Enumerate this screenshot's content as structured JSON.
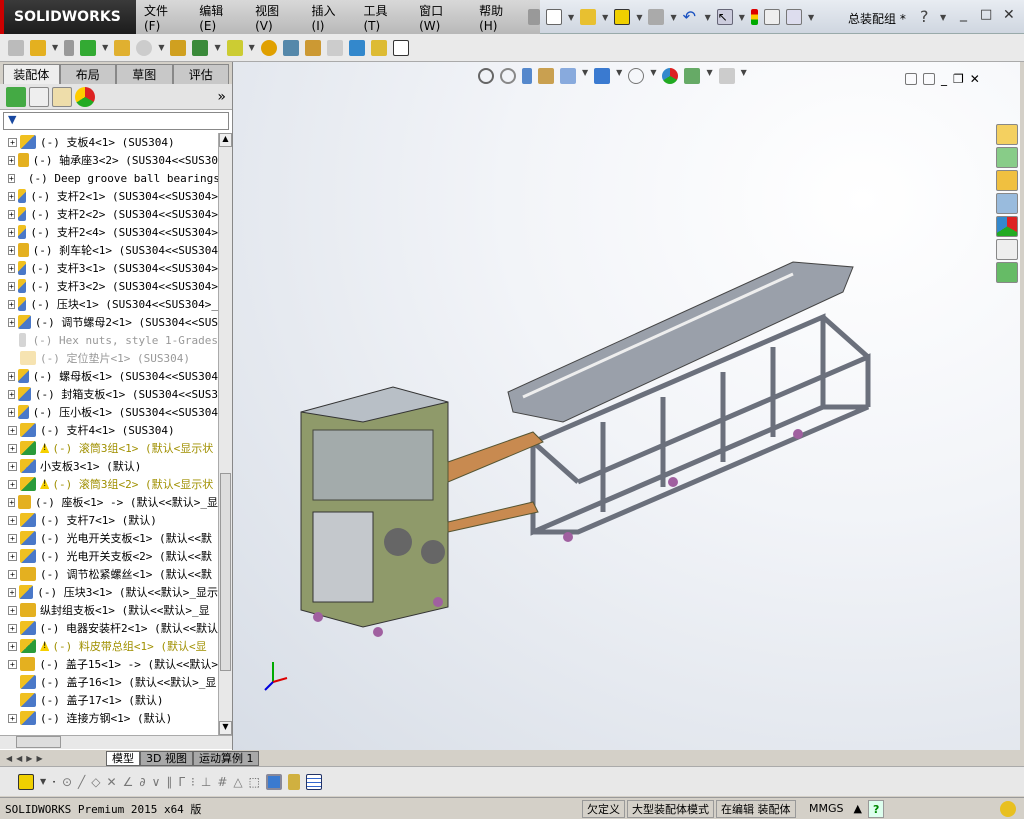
{
  "app": {
    "logo": "SOLIDWORKS",
    "doc_title": "总装配组 *"
  },
  "menu": [
    "文件(F)",
    "编辑(E)",
    "视图(V)",
    "插入(I)",
    "工具(T)",
    "窗口(W)",
    "帮助(H)"
  ],
  "panel_tabs": [
    "装配体",
    "布局",
    "草图",
    "评估"
  ],
  "panel_more": "»",
  "tree": [
    {
      "t": "(-) 支板4<1> (SUS304)",
      "k": "asm"
    },
    {
      "t": "(-) 轴承座3<2> (SUS304<<SUS30",
      "k": "part"
    },
    {
      "t": "(-) Deep groove ball bearings",
      "k": "tool"
    },
    {
      "t": "(-) 支杆2<1> (SUS304<<SUS304>",
      "k": "asm"
    },
    {
      "t": "(-) 支杆2<2> (SUS304<<SUS304>",
      "k": "asm"
    },
    {
      "t": "(-) 支杆2<4> (SUS304<<SUS304>",
      "k": "asm"
    },
    {
      "t": "(-) 刹车轮<1> (SUS304<<SUS304",
      "k": "part"
    },
    {
      "t": "(-) 支杆3<1> (SUS304<<SUS304>",
      "k": "asm"
    },
    {
      "t": "(-) 支杆3<2> (SUS304<<SUS304>",
      "k": "asm"
    },
    {
      "t": "(-) 压块<1> (SUS304<<SUS304>_",
      "k": "asm"
    },
    {
      "t": "(-) 调节螺母2<1> (SUS304<<SUS",
      "k": "asm"
    },
    {
      "t": "(-) Hex nuts, style 1-Grades",
      "k": "tool",
      "s": "sup"
    },
    {
      "t": "(-) 定位垫片<1> (SUS304)",
      "k": "part",
      "s": "sup"
    },
    {
      "t": "(-) 螺母板<1> (SUS304<<SUS304",
      "k": "asm"
    },
    {
      "t": "(-) 封箱支板<1> (SUS304<<SUS3",
      "k": "asm"
    },
    {
      "t": "(-) 压小板<1> (SUS304<<SUS304",
      "k": "asm"
    },
    {
      "t": "(-) 支杆4<1> (SUS304)",
      "k": "asm"
    },
    {
      "t": "(-) 滚筒3组<1> (默认<显示状",
      "k": "sub",
      "s": "ylw"
    },
    {
      "t": "小支板3<1> (默认)",
      "k": "asm"
    },
    {
      "t": "(-) 滚筒3组<2> (默认<显示状",
      "k": "sub",
      "s": "ylw"
    },
    {
      "t": "(-) 座板<1> -> (默认<<默认>_显",
      "k": "part"
    },
    {
      "t": "(-) 支杆7<1> (默认)",
      "k": "asm"
    },
    {
      "t": "(-) 光电开关支板<1> (默认<<默",
      "k": "asm"
    },
    {
      "t": "(-) 光电开关支板<2> (默认<<默",
      "k": "asm"
    },
    {
      "t": "(-) 调节松紧螺丝<1> (默认<<默",
      "k": "part"
    },
    {
      "t": "(-) 压块3<1> (默认<<默认>_显示",
      "k": "asm"
    },
    {
      "t": "纵封组支板<1> (默认<<默认>_显",
      "k": "part"
    },
    {
      "t": "(-) 电器安装杆2<1> (默认<<默认",
      "k": "asm"
    },
    {
      "t": "(-) 料皮带总组<1> (默认<显",
      "k": "sub",
      "s": "ylw"
    },
    {
      "t": "(-) 盖子15<1> -> (默认<<默认>",
      "k": "part"
    },
    {
      "t": "(-) 盖子16<1> (默认<<默认>_显",
      "k": "asm",
      "nx": true
    },
    {
      "t": "(-) 盖子17<1> (默认)",
      "k": "asm",
      "nx": true
    },
    {
      "t": "(-) 连接方钢<1> (默认)",
      "k": "asm"
    }
  ],
  "bottom_tabs": [
    "模型",
    "3D 视图",
    "运动算例 1"
  ],
  "status": {
    "product": "SOLIDWORKS Premium 2015 x64 版",
    "state": "欠定义",
    "mode": "大型装配体模式",
    "editing": "在编辑 装配体",
    "units": "MMGS"
  },
  "colors": {
    "frame": "#8a8f9a",
    "accent": "#c00000"
  }
}
